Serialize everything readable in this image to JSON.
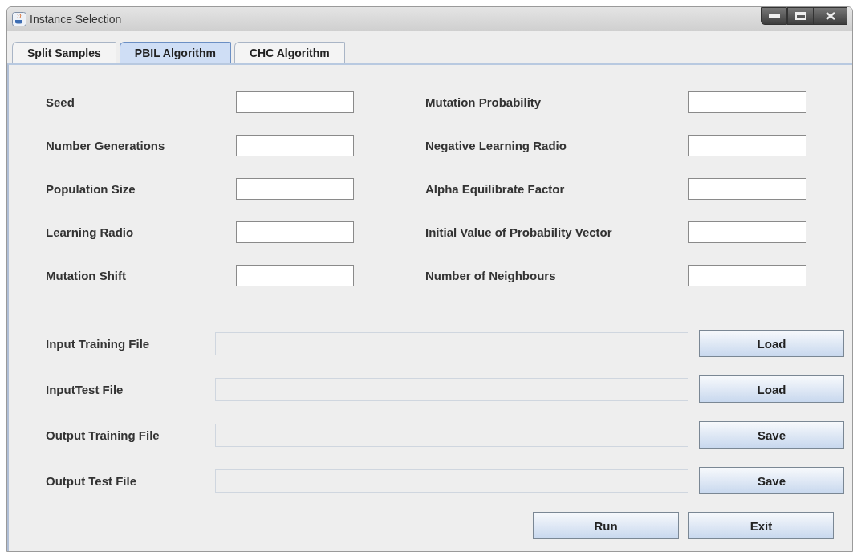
{
  "window": {
    "title": "Instance Selection"
  },
  "tabs": [
    {
      "label": "Split Samples",
      "selected": false
    },
    {
      "label": "PBIL Algorithm",
      "selected": true
    },
    {
      "label": "CHC Algorithm",
      "selected": false
    }
  ],
  "parameters": [
    {
      "label": "Seed"
    },
    {
      "label": "Mutation Probability"
    },
    {
      "label": "Number Generations"
    },
    {
      "label": "Negative Learning Radio"
    },
    {
      "label": "Population Size"
    },
    {
      "label": "Alpha Equilibrate Factor"
    },
    {
      "label": "Learning Radio"
    },
    {
      "label": "Initial Value of Probability Vector"
    },
    {
      "label": "Mutation Shift"
    },
    {
      "label": "Number of Neighbours"
    }
  ],
  "files": [
    {
      "label": "Input Training File",
      "button": "Load",
      "disabled": true
    },
    {
      "label": "InputTest File",
      "button": "Load",
      "disabled": true
    },
    {
      "label": "Output Training File",
      "button": "Save",
      "disabled": true
    },
    {
      "label": "Output Test File",
      "button": "Save",
      "disabled": true
    }
  ],
  "actions": [
    "Run",
    "Exit"
  ]
}
